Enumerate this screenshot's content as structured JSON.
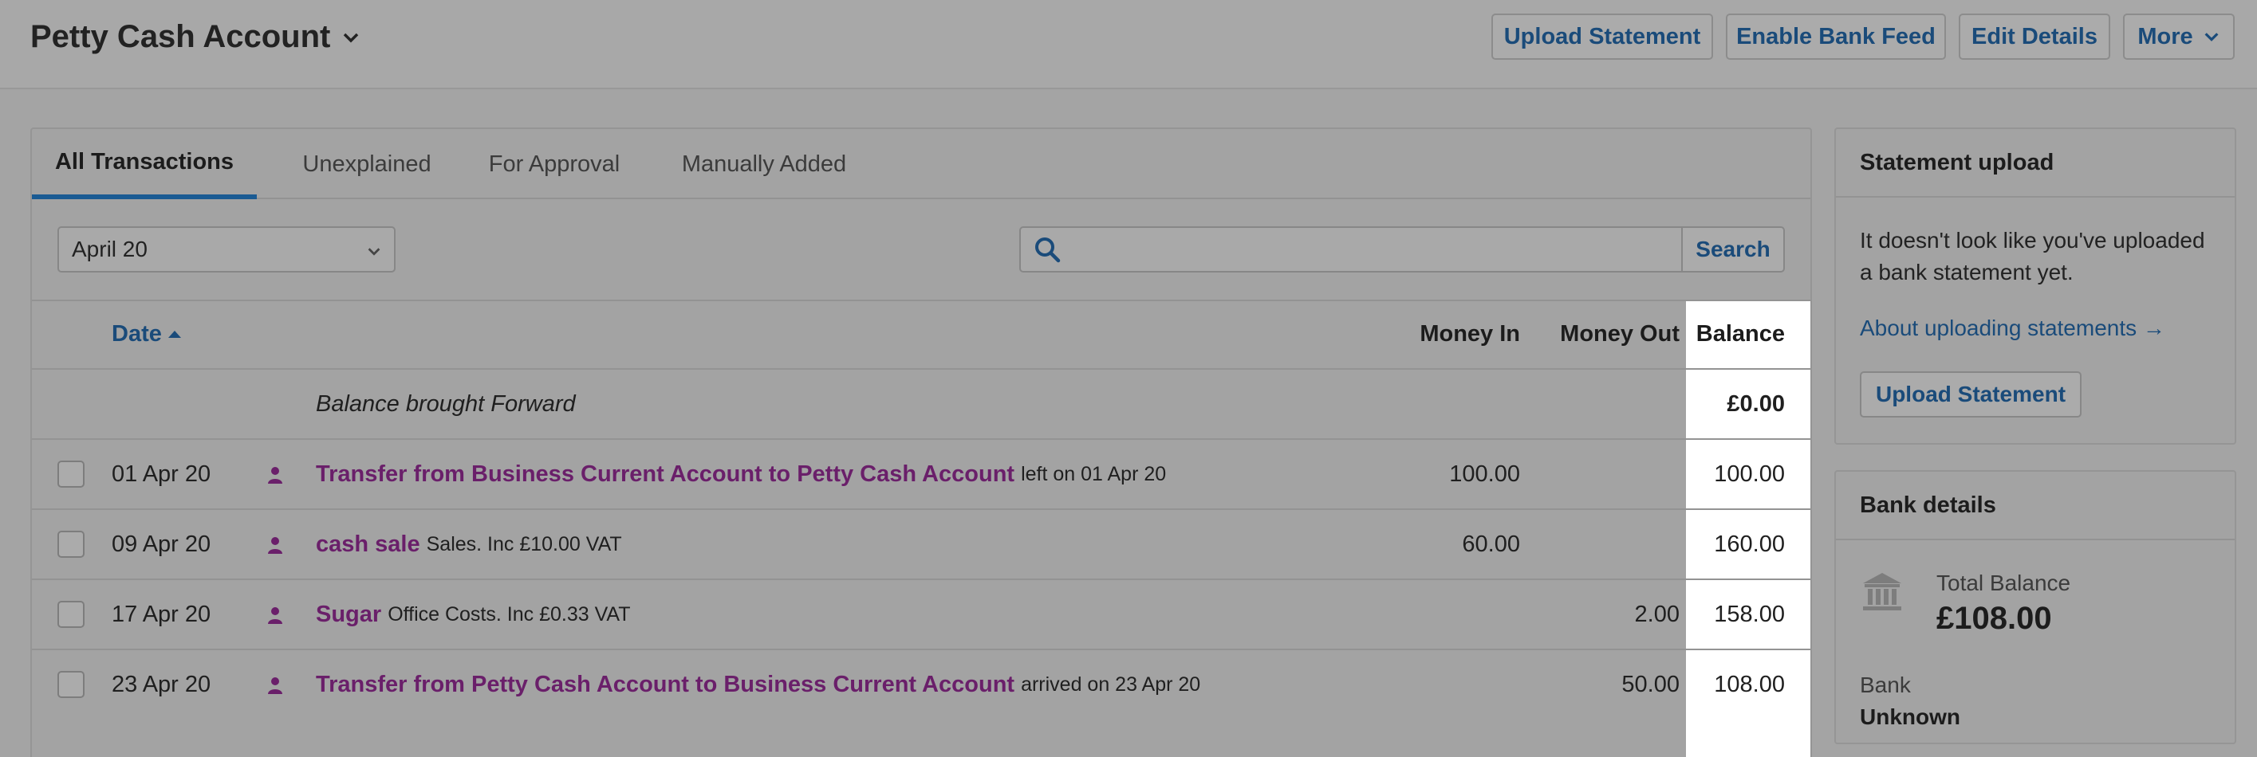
{
  "header": {
    "title": "Petty Cash Account",
    "buttons": {
      "upload_statement": "Upload Statement",
      "enable_bank_feed": "Enable Bank Feed",
      "edit_details": "Edit Details",
      "more": "More"
    }
  },
  "tabs": [
    "All Transactions",
    "Unexplained",
    "For Approval",
    "Manually Added"
  ],
  "active_tab": "All Transactions",
  "filter": {
    "month": "April 20"
  },
  "search": {
    "value": "",
    "button": "Search"
  },
  "table": {
    "columns": {
      "date": "Date",
      "money_in": "Money In",
      "money_out": "Money Out",
      "balance": "Balance"
    },
    "sort": {
      "column": "Date",
      "direction": "ascending"
    },
    "brought_forward": {
      "label": "Balance brought Forward",
      "balance": "£0.00"
    },
    "rows": [
      {
        "date": "01 Apr 20",
        "link": "Transfer from Business Current Account to Petty Cash Account",
        "detail": "left on 01 Apr 20",
        "money_in": "100.00",
        "money_out": "",
        "balance": "100.00"
      },
      {
        "date": "09 Apr 20",
        "link": "cash sale",
        "detail": "Sales. Inc £10.00 VAT",
        "money_in": "60.00",
        "money_out": "",
        "balance": "160.00"
      },
      {
        "date": "17 Apr 20",
        "link": "Sugar",
        "detail": "Office Costs. Inc £0.33 VAT",
        "money_in": "",
        "money_out": "2.00",
        "balance": "158.00"
      },
      {
        "date": "23 Apr 20",
        "link": "Transfer from Petty Cash Account to Business Current Account",
        "detail": "arrived on 23 Apr 20",
        "money_in": "",
        "money_out": "50.00",
        "balance": "108.00"
      }
    ]
  },
  "statement_upload": {
    "title": "Statement upload",
    "text": "It doesn't look like you've uploaded a bank statement yet.",
    "link": "About uploading statements →",
    "button": "Upload Statement"
  },
  "bank_details": {
    "title": "Bank details",
    "total_balance_label": "Total Balance",
    "total_balance": "£108.00",
    "bank_label": "Bank",
    "bank_value": "Unknown"
  },
  "icons": {
    "title_chevron": "chevron-down-icon",
    "more_chevron": "chevron-down-icon",
    "select_chevron": "chevron-down-icon",
    "search": "search-icon",
    "sort": "sort-ascending-icon",
    "row_user": "person-icon",
    "bank": "bank-icon"
  },
  "colors": {
    "link_blue": "#1a4b7a",
    "transaction_purple": "#6a1f6a",
    "active_tab_underline": "#1a5b93"
  }
}
